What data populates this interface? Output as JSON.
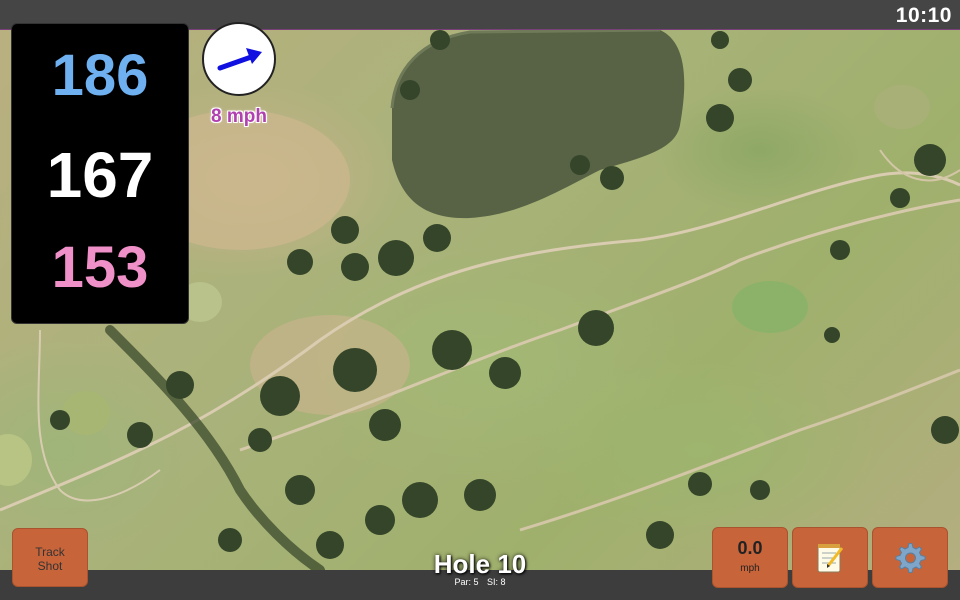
{
  "status": {
    "clock": "10:10"
  },
  "yardages": {
    "back": "186",
    "center": "167",
    "front": "153"
  },
  "wind": {
    "speed_label": "8 mph",
    "icon": "wind-arrow-icon",
    "color": "#b040b0"
  },
  "hole": {
    "title": "Hole 10",
    "par_label": "Par: 5",
    "si_label": "SI: 8"
  },
  "buttons": {
    "track_shot_line1": "Track",
    "track_shot_line2": "Shot",
    "speed_value": "0.0",
    "speed_unit": "mph",
    "notes_icon": "notepad-icon",
    "settings_icon": "gear-icon"
  },
  "colors": {
    "back_yardage": "#6fb0f0",
    "center_yardage": "#ffffff",
    "front_yardage": "#f090c8",
    "button": "#c8643a"
  }
}
